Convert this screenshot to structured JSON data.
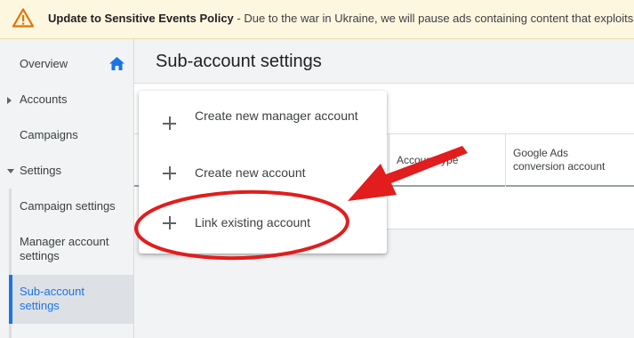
{
  "banner": {
    "icon": "warning-icon",
    "title": "Update to Sensitive Events Policy",
    "message": " - Due to the war in Ukraine, we will pause ads containing content that exploits, dis"
  },
  "sidebar": {
    "items": [
      {
        "label": "Overview",
        "icon": "home-icon"
      },
      {
        "label": "Accounts",
        "icon": "expand-arrow-icon"
      },
      {
        "label": "Campaigns"
      },
      {
        "label": "Settings",
        "icon": "collapse-arrow-icon"
      },
      {
        "label": "Campaign settings"
      },
      {
        "label": "Manager account settings"
      },
      {
        "label": "Sub-account settings",
        "active": true
      }
    ]
  },
  "page": {
    "title": "Sub-account settings"
  },
  "table": {
    "columns": [
      "Account type",
      "Google Ads conversion account"
    ]
  },
  "menu": {
    "items": [
      {
        "label": "Create new manager account",
        "icon": "plus-icon"
      },
      {
        "label": "Create new account",
        "icon": "plus-icon"
      },
      {
        "label": "Link existing account",
        "icon": "plus-icon",
        "highlighted": true
      }
    ]
  },
  "colors": {
    "accent": "#1a73e8",
    "annotation": "#e11d1d",
    "warning": "#e37400"
  }
}
